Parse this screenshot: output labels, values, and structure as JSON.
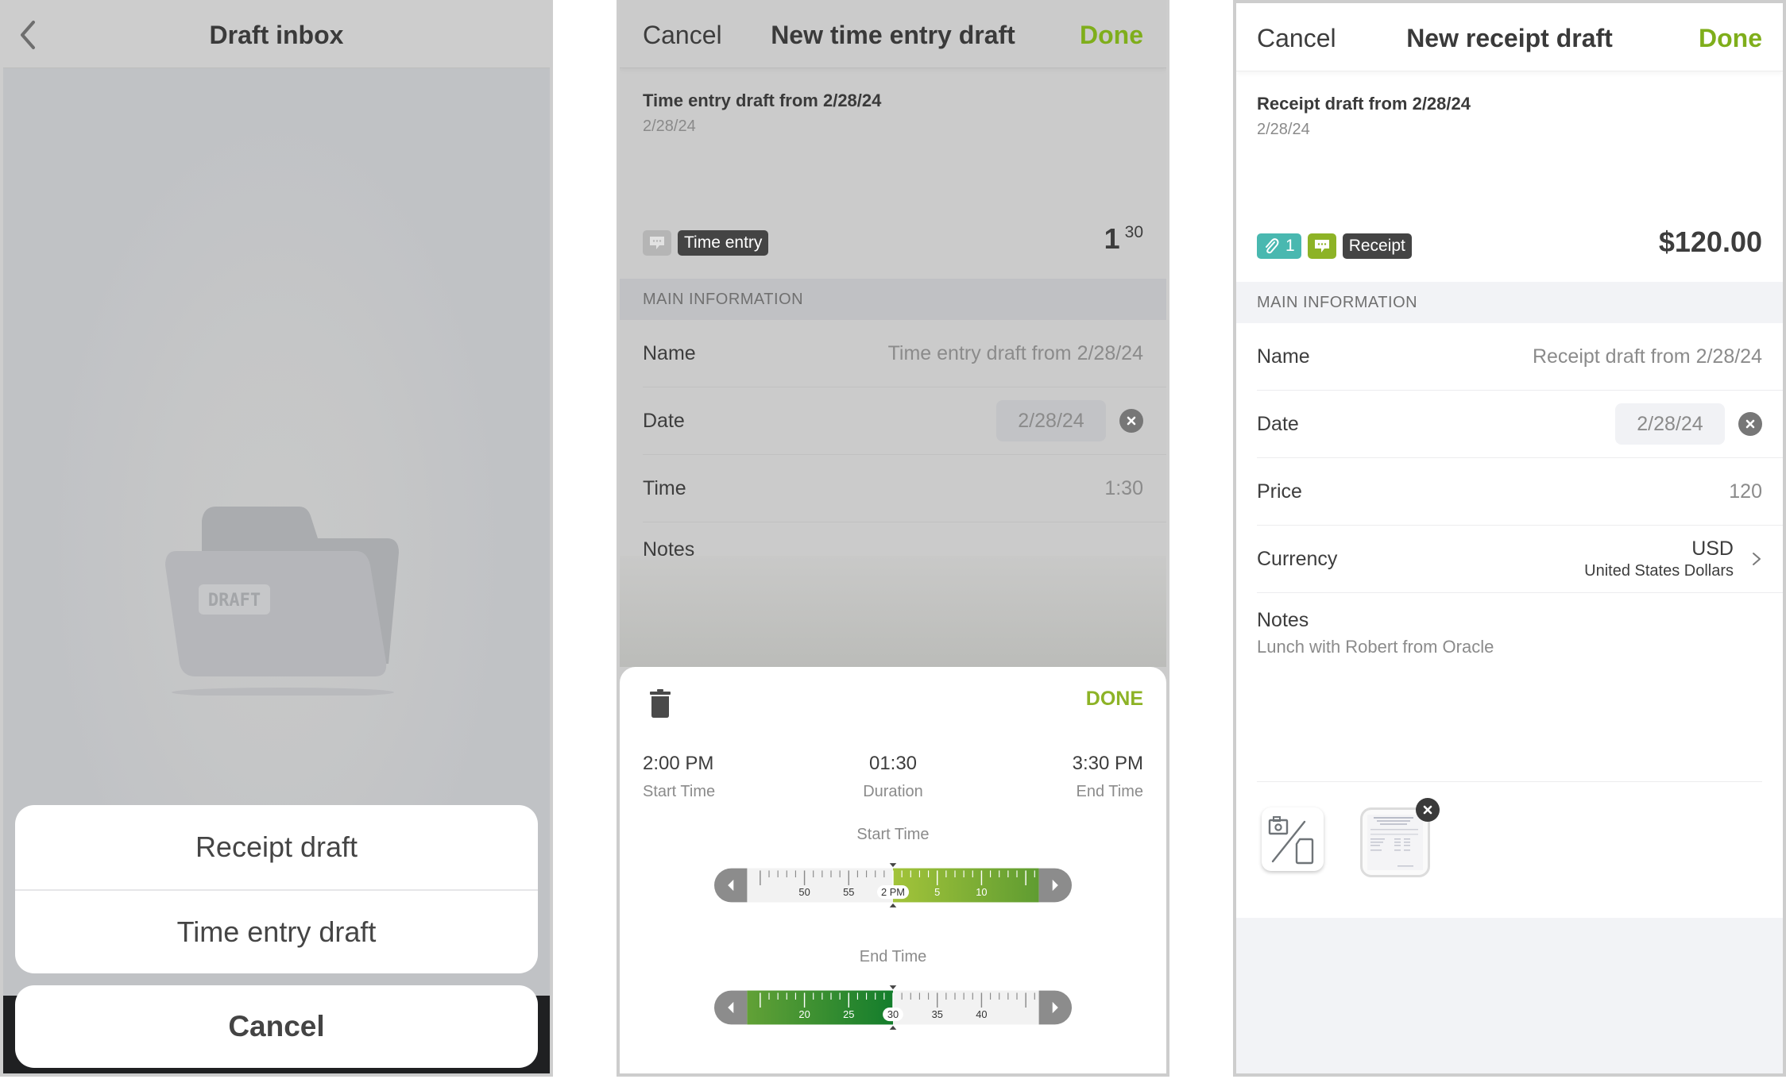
{
  "draft_inbox": {
    "title": "Draft inbox",
    "back_icon": "chevron-left-icon",
    "empty_state_icon": "draft-folder-icon",
    "folder_label": "DRAFT",
    "action_sheet": {
      "options": [
        "Receipt draft",
        "Time entry draft"
      ],
      "cancel_label": "Cancel"
    }
  },
  "time_entry": {
    "nav": {
      "cancel": "Cancel",
      "title": "New time entry draft",
      "done": "Done"
    },
    "summary": {
      "title": "Time entry draft from 2/28/24",
      "date": "2/28/24",
      "type_badge": "Time entry",
      "hours": "1",
      "minutes": "30"
    },
    "section_header": "MAIN INFORMATION",
    "fields": {
      "name_label": "Name",
      "name_value": "Time entry draft from 2/28/24",
      "date_label": "Date",
      "date_value": "2/28/24",
      "time_label": "Time",
      "time_value": "1:30",
      "notes_label": "Notes"
    },
    "picker": {
      "done": "DONE",
      "start_value": "2:00 PM",
      "start_label": "Start Time",
      "duration_value": "01:30",
      "duration_label": "Duration",
      "end_value": "3:30 PM",
      "end_label": "End Time",
      "start_ruler": {
        "label": "Start Time",
        "ticks": [
          "50",
          "55",
          "2 PM",
          "5",
          "10"
        ],
        "selected": "2 PM"
      },
      "end_ruler": {
        "label": "End Time",
        "ticks": [
          "20",
          "25",
          "30",
          "35",
          "40"
        ],
        "selected": "30"
      }
    }
  },
  "receipt": {
    "nav": {
      "cancel": "Cancel",
      "title": "New receipt draft",
      "done": "Done"
    },
    "summary": {
      "title": "Receipt draft from 2/28/24",
      "date": "2/28/24",
      "attachment_count": "1",
      "type_badge": "Receipt",
      "amount": "$120.00"
    },
    "section_header": "MAIN INFORMATION",
    "fields": {
      "name_label": "Name",
      "name_value": "Receipt draft from 2/28/24",
      "date_label": "Date",
      "date_value": "2/28/24",
      "price_label": "Price",
      "price_value": "120",
      "currency_label": "Currency",
      "currency_code": "USD",
      "currency_name": "United States Dollars",
      "notes_label": "Notes",
      "notes_value": "Lunch with Robert from Oracle"
    },
    "attachments": {
      "add_icon": "camera-or-file-icon",
      "items": [
        "receipt-image-thumbnail"
      ]
    }
  },
  "colors": {
    "accent_green": "#7fae1b",
    "teal_badge": "#49b8b0",
    "note_badge": "#8db326",
    "dark_badge": "#444444"
  }
}
